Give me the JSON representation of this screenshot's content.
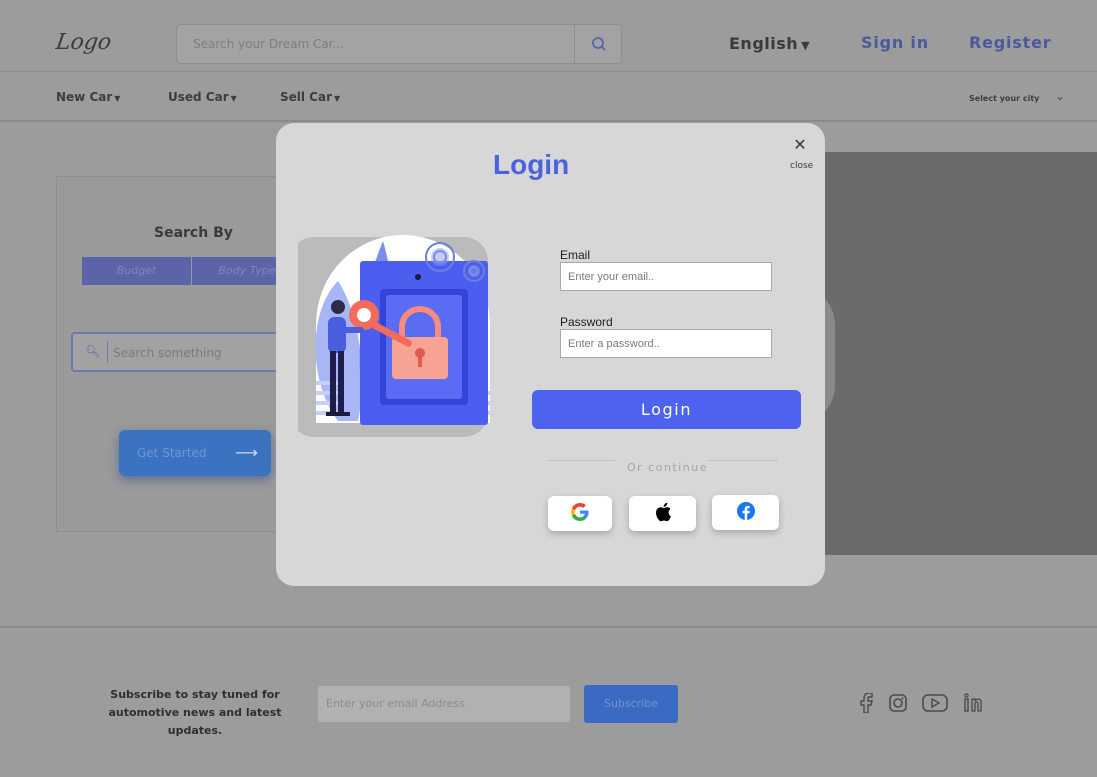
{
  "header": {
    "logo": "Logo",
    "search_placeholder": "Search your Dream Car...",
    "language": "English",
    "sign_in": "Sign in",
    "register": "Register"
  },
  "nav": {
    "items": [
      {
        "label": "New Car"
      },
      {
        "label": "Used Car"
      },
      {
        "label": "Sell Car"
      }
    ],
    "city_select": "Select your city"
  },
  "search_card": {
    "title": "Search By",
    "tabs": [
      "Budget",
      "Body Type"
    ],
    "search_placeholder": "Search something",
    "cta": "Get Started"
  },
  "footer": {
    "subscribe_text": "Subscribe to stay tuned for automotive news and latest updates.",
    "email_placeholder": "Enter your email Address",
    "subscribe_button": "Subscribe",
    "social_icons": [
      "facebook-icon",
      "instagram-icon",
      "youtube-icon",
      "linkedin-icon"
    ]
  },
  "modal": {
    "title": "Login",
    "close_label": "close",
    "email_label": "Email",
    "email_placeholder": "Enter your email..",
    "password_label": "Password",
    "password_placeholder": "Enter a password..",
    "login_button": "Login",
    "divider_text": "Or continue",
    "social_providers": [
      "google-icon",
      "apple-icon",
      "facebook-icon"
    ]
  },
  "colors": {
    "accent": "#4d63f0",
    "title": "#4a62e0",
    "overlay": "#9c9c9c",
    "modal_bg": "#d7d7d7"
  }
}
